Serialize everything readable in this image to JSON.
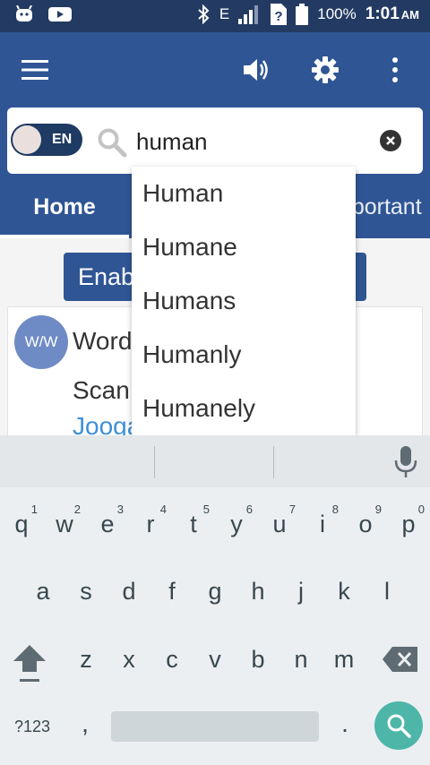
{
  "status_bar": {
    "network": "E",
    "battery": "100%",
    "time": "1:01",
    "ampm": "AM"
  },
  "search": {
    "toggle_label": "EN",
    "query": "human"
  },
  "tabs": {
    "home": "Home",
    "partial_tab": "mportant"
  },
  "content": {
    "enable_button": "Enab",
    "avatar_text": "W/W",
    "card_title": "Word",
    "card_line2": "Scan",
    "card_link": "Jooga"
  },
  "suggestions": [
    "Human",
    "Humane",
    "Humans",
    "Humanly",
    "Humanely"
  ],
  "keyboard": {
    "row1": [
      {
        "key": "q",
        "hint": "1"
      },
      {
        "key": "w",
        "hint": "2"
      },
      {
        "key": "e",
        "hint": "3"
      },
      {
        "key": "r",
        "hint": "4"
      },
      {
        "key": "t",
        "hint": "5"
      },
      {
        "key": "y",
        "hint": "6"
      },
      {
        "key": "u",
        "hint": "7"
      },
      {
        "key": "i",
        "hint": "8"
      },
      {
        "key": "o",
        "hint": "9"
      },
      {
        "key": "p",
        "hint": "0"
      }
    ],
    "row2": [
      "a",
      "s",
      "d",
      "f",
      "g",
      "h",
      "j",
      "k",
      "l"
    ],
    "row3": [
      "z",
      "x",
      "c",
      "v",
      "b",
      "n",
      "m"
    ],
    "symbols_key": "?123",
    "comma": ",",
    "period": "."
  },
  "colors": {
    "app_bar": "#2f5594",
    "status_bar": "#233b62",
    "accent_go": "#4db6a9",
    "link": "#3d8fd9"
  },
  "icons": [
    "android-icon",
    "youtube-icon",
    "bluetooth-icon",
    "signal-icon",
    "battery-icon",
    "menu-icon",
    "volume-icon",
    "settings-icon",
    "more-icon",
    "search-icon",
    "clear-icon",
    "mic-icon",
    "shift-icon",
    "backspace-icon"
  ]
}
